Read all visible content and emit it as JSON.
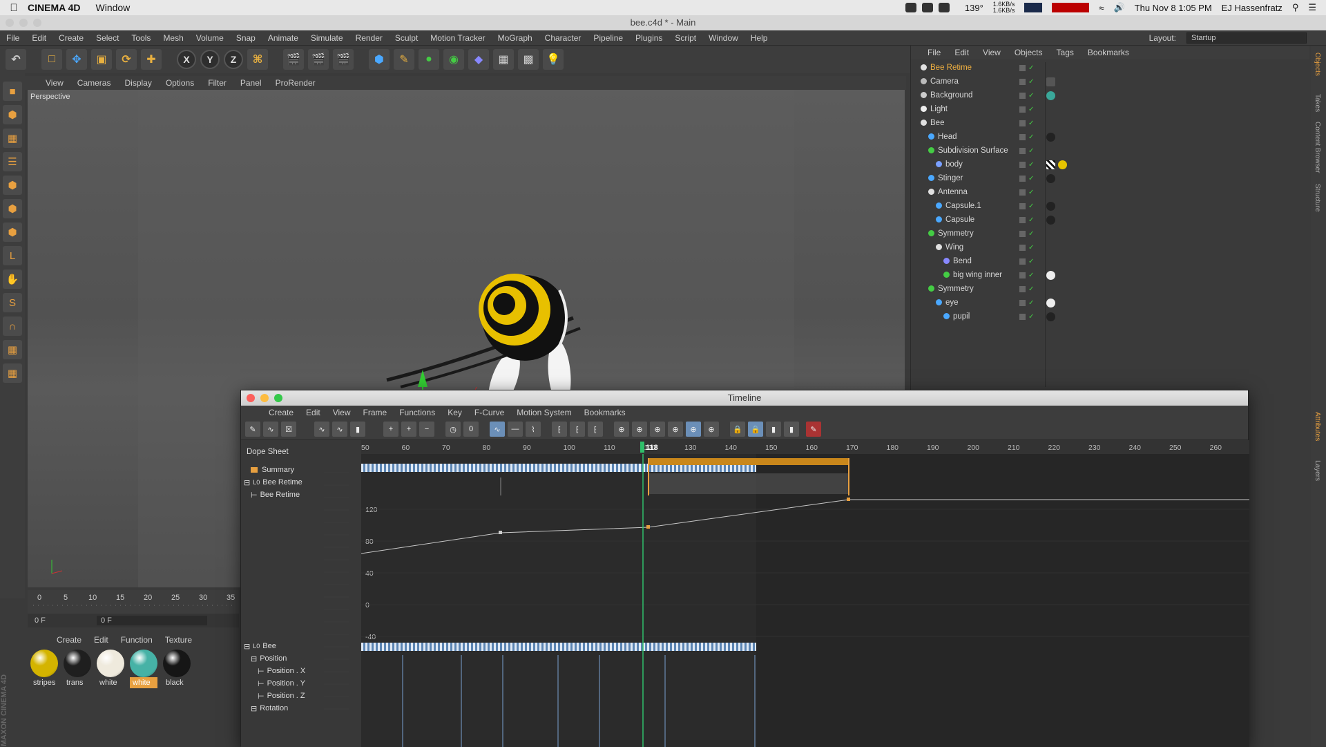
{
  "macbar": {
    "app": "CINEMA 4D",
    "menus": [
      "Window"
    ],
    "temp": "139°",
    "net_up": "1.6KB/s",
    "net_down": "1.6KB/s",
    "datetime": "Thu Nov 8  1:05 PM",
    "user": "EJ Hassenfratz"
  },
  "window_title": "bee.c4d * - Main",
  "app_menu": [
    "File",
    "Edit",
    "Create",
    "Select",
    "Tools",
    "Mesh",
    "Volume",
    "Snap",
    "Animate",
    "Simulate",
    "Render",
    "Sculpt",
    "Motion Tracker",
    "MoGraph",
    "Character",
    "Pipeline",
    "Plugins",
    "Script",
    "Window",
    "Help"
  ],
  "layout": {
    "label": "Layout:",
    "value": "Startup"
  },
  "viewport": {
    "menu": [
      "View",
      "Cameras",
      "Display",
      "Options",
      "Filter",
      "Panel",
      "ProRender"
    ],
    "label": "Perspective"
  },
  "object_manager": {
    "menu": [
      "File",
      "Edit",
      "View",
      "Objects",
      "Tags",
      "Bookmarks"
    ],
    "objects": [
      {
        "name": "Bee Retime",
        "indent": 0,
        "icon": "null",
        "highlight": true,
        "tags": []
      },
      {
        "name": "Camera",
        "indent": 0,
        "icon": "camera",
        "tags": [
          "cam"
        ]
      },
      {
        "name": "Background",
        "indent": 0,
        "icon": "background",
        "tags": [
          "#3aa89a"
        ]
      },
      {
        "name": "Light",
        "indent": 0,
        "icon": "light",
        "tags": []
      },
      {
        "name": "Bee",
        "indent": 0,
        "icon": "null",
        "tags": []
      },
      {
        "name": "Head",
        "indent": 1,
        "icon": "sphere",
        "tags": [
          "#222"
        ]
      },
      {
        "name": "Subdivision Surface",
        "indent": 1,
        "icon": "subdiv",
        "tags": []
      },
      {
        "name": "body",
        "indent": 2,
        "icon": "mesh",
        "tags": [
          "checker",
          "#e6c300"
        ]
      },
      {
        "name": "Stinger",
        "indent": 1,
        "icon": "cone",
        "tags": [
          "#222"
        ]
      },
      {
        "name": "Antenna",
        "indent": 1,
        "icon": "null",
        "tags": []
      },
      {
        "name": "Capsule.1",
        "indent": 2,
        "icon": "capsule",
        "tags": [
          "#222"
        ]
      },
      {
        "name": "Capsule",
        "indent": 2,
        "icon": "capsule",
        "tags": [
          "#222"
        ]
      },
      {
        "name": "Symmetry",
        "indent": 1,
        "icon": "symmetry",
        "tags": []
      },
      {
        "name": "Wing",
        "indent": 2,
        "icon": "null",
        "tags": []
      },
      {
        "name": "Bend",
        "indent": 3,
        "icon": "bend",
        "tags": []
      },
      {
        "name": "big wing inner",
        "indent": 3,
        "icon": "subdiv",
        "tags": [
          "#eee"
        ]
      },
      {
        "name": "Symmetry",
        "indent": 1,
        "icon": "symmetry",
        "tags": []
      },
      {
        "name": "eye",
        "indent": 2,
        "icon": "sphere",
        "tags": [
          "#eee"
        ]
      },
      {
        "name": "pupil",
        "indent": 3,
        "icon": "sphere",
        "tags": [
          "#222"
        ]
      }
    ]
  },
  "right_side_tabs": [
    "Objects",
    "Takes",
    "Content Browser",
    "Structure",
    "Attributes",
    "Layers"
  ],
  "bottom_timeline": {
    "ticks": [
      "0",
      "5",
      "10",
      "15",
      "20",
      "25",
      "30",
      "35"
    ],
    "frame_value": "0 F",
    "frame_value2": "0 F"
  },
  "materials": {
    "menu": [
      "Create",
      "Edit",
      "Function",
      "Texture"
    ],
    "items": [
      {
        "label": "stripes",
        "color": "#d4b400",
        "selected": false
      },
      {
        "label": "trans",
        "color": "#1f1f1f",
        "selected": false
      },
      {
        "label": "white",
        "color": "#efeadd",
        "selected": false
      },
      {
        "label": "white",
        "color": "#46b2a6",
        "selected": true
      },
      {
        "label": "black",
        "color": "#161616",
        "selected": false
      }
    ]
  },
  "maxon_label": "MAXON CINEMA 4D",
  "timeline": {
    "title": "Timeline",
    "menu": [
      "Create",
      "Edit",
      "View",
      "Frame",
      "Functions",
      "Key",
      "F-Curve",
      "Motion System",
      "Bookmarks"
    ],
    "mode": "Dope Sheet",
    "current_frame": "118",
    "ruler": [
      "50",
      "60",
      "70",
      "80",
      "90",
      "100",
      "110",
      "120",
      "130",
      "140",
      "150",
      "160",
      "170",
      "180",
      "190",
      "200",
      "210",
      "220",
      "230",
      "240",
      "250",
      "260"
    ],
    "tracks_top": [
      "Summary",
      "Bee Retime",
      "Bee Retime"
    ],
    "fcurve_axis": [
      "120",
      "80",
      "40",
      "0",
      "-40"
    ],
    "tracks_bottom": [
      "Bee",
      "Position",
      "Position . X",
      "Position . Y",
      "Position . Z",
      "Rotation"
    ]
  }
}
